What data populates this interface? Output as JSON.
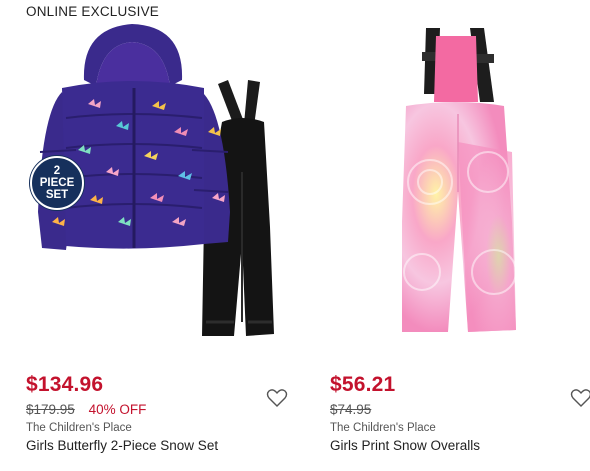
{
  "products": [
    {
      "tag": "ONLINE EXCLUSIVE",
      "badge_lines": [
        "2",
        "PIECE",
        "SET"
      ],
      "price": "$134.96",
      "original_price": "$179.95",
      "discount": "40% OFF",
      "brand": "The Children's Place",
      "name": "Girls Butterfly 2-Piece Snow Set",
      "icons": [
        "butterfly-jacket-image",
        "black-snow-pants-image",
        "heart-icon"
      ]
    },
    {
      "price": "$56.21",
      "original_price": "$74.95",
      "brand": "The Children's Place",
      "name": "Girls Print Snow Overalls",
      "icons": [
        "tie-dye-snow-overalls-image",
        "heart-icon"
      ]
    }
  ],
  "colors": {
    "sale_price": "#c3122d",
    "jacket_purple": "#3a2a8c",
    "badge_navy": "#16305c"
  }
}
